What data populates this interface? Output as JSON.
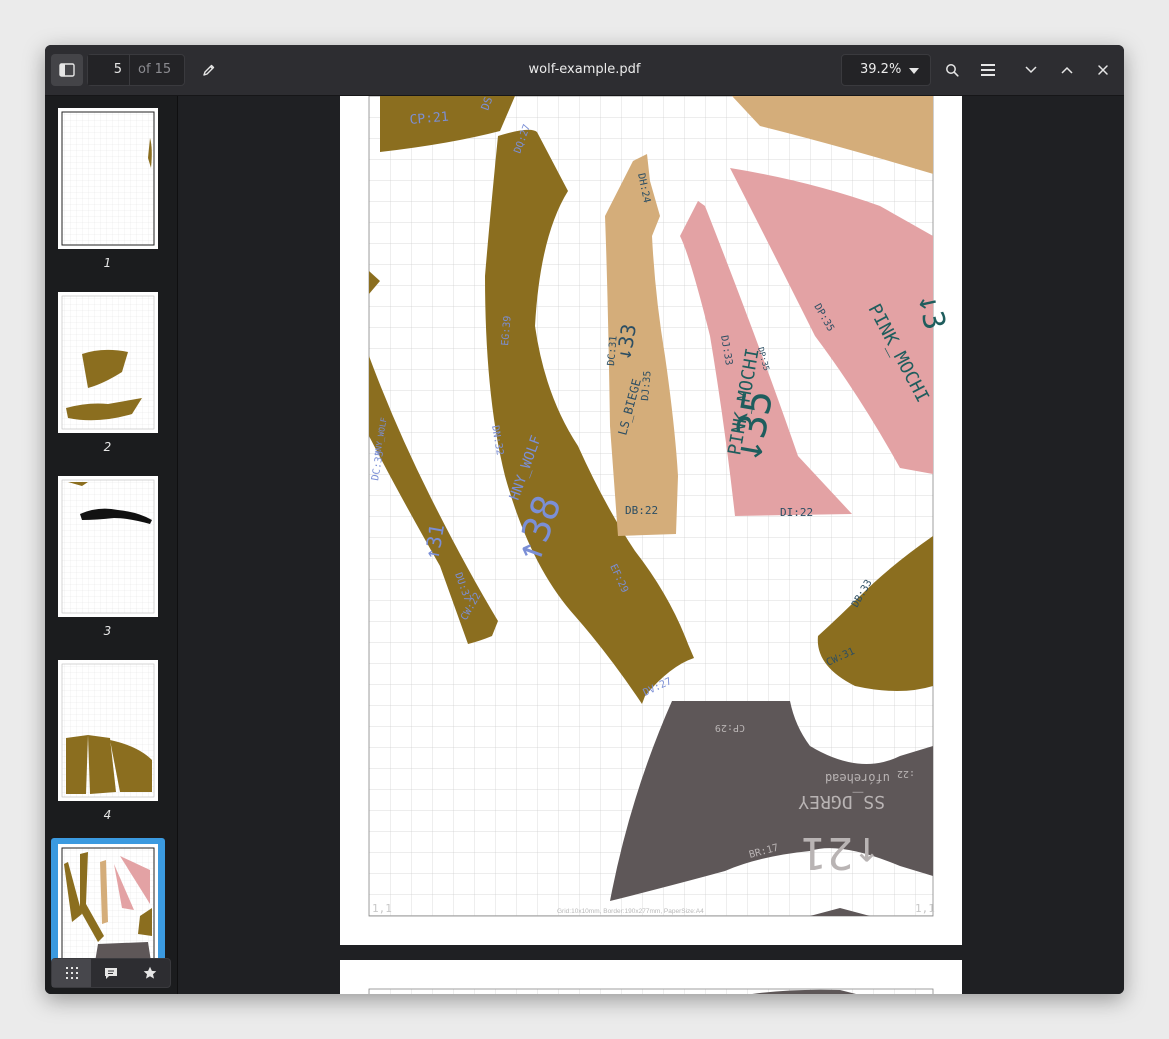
{
  "document": {
    "filename": "wolf-example.pdf",
    "current_page": "5",
    "page_total": "of 15",
    "zoom": "39.2%"
  },
  "thumbnails": [
    {
      "label": "1"
    },
    {
      "label": "2"
    },
    {
      "label": "3"
    },
    {
      "label": "4"
    },
    {
      "label": "5",
      "selected": true
    }
  ],
  "colors": {
    "olive": "#8b6e1f",
    "tan": "#d4ad7a",
    "pink": "#e3a2a4",
    "grey": "#5e5758",
    "teal_label": "#1f5d5d",
    "blue_label": "#7b8fd6"
  },
  "pattern_labels": {
    "cp21": "CP:21",
    "ds": "DS",
    "dh24": "DH:24",
    "dq27": "DQ:27",
    "eg39": "EG:39",
    "dn32": "DN:32",
    "hny_wolf": "HNY_WOLF",
    "num38": "↑38",
    "ef29": "EF:29",
    "dv27": "DV:27",
    "dc33": "DC:33",
    "hny_wolf_small": "HNY_WOLF",
    "num31": "↑31",
    "du37": "DU:37",
    "cw22": "CW:22",
    "dc31": "DC:31",
    "ls_biege": "LS_BIEGE",
    "num33": "↓33",
    "dj35": "DJ:35",
    "db22": "DB:22",
    "dj33": "DJ:33",
    "pink_mochi": "PINK_MOCHI",
    "num35": "↓35",
    "dp35": "DP:35",
    "di22": "DI:22",
    "pink_mochi_2": "PINK_MOCHI",
    "dp35b": "DP:35",
    "db33": "DB:33",
    "cw31": "CW:31",
    "cp29": "CP:29",
    "ss_dgrey": "SS_DGREY",
    "uforehead": "ufórehead",
    "num21": "↑21",
    "br17": "BR:17",
    "x22": ":22",
    "corner_left": "1,1",
    "corner_right": "1,1",
    "grid_info": "Grid:10x10mm, Border:190x277mm, PaperSize:A4"
  }
}
